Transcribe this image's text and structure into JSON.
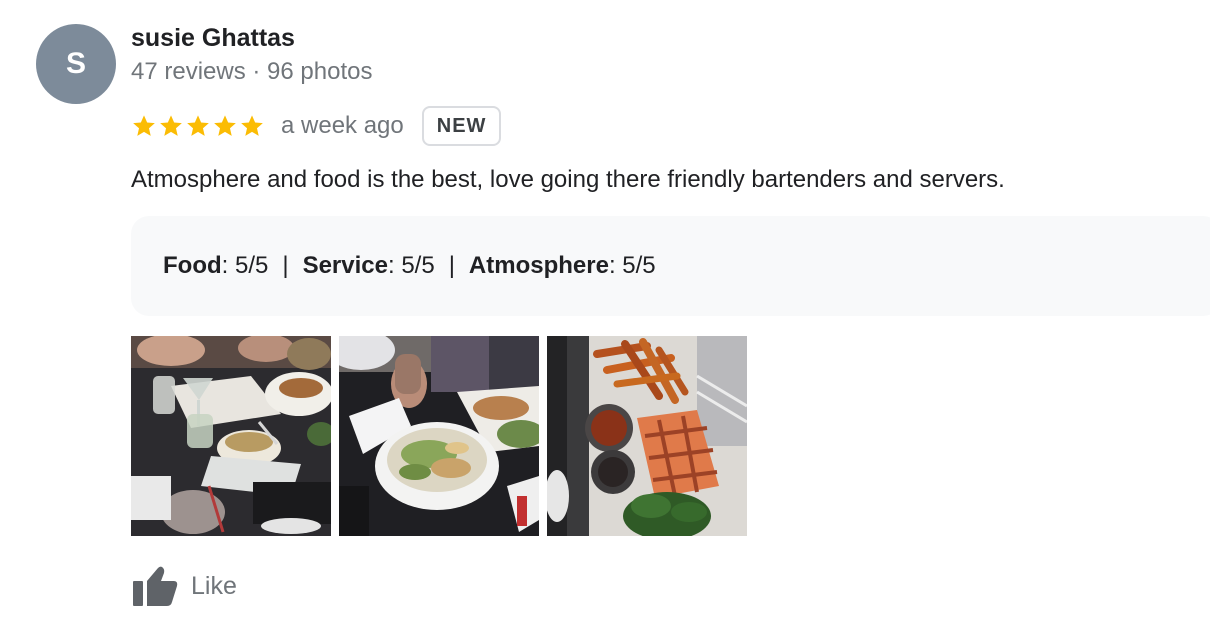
{
  "reviewer": {
    "initial": "S",
    "name": "susie Ghattas",
    "stats": "47 reviews · 96 photos",
    "avatar_color": "#7d8b9a"
  },
  "review": {
    "rating": 5,
    "max_rating": 5,
    "star_color": "#fbbc04",
    "time": "a week ago",
    "badge": "NEW",
    "text": "Atmosphere and food is the best, love going there friendly bartenders and servers."
  },
  "attributes": {
    "food_label": "Food",
    "food_value": ": 5/5",
    "service_label": "Service",
    "service_value": ": 5/5",
    "atmosphere_label": "Atmosphere",
    "atmosphere_value": ": 5/5",
    "separator": "|"
  },
  "photos": [
    {
      "subject": "restaurant table with drinks and soup"
    },
    {
      "subject": "salad bowl on table"
    },
    {
      "subject": "grilled salmon with fries and greens"
    }
  ],
  "actions": {
    "like_label": "Like",
    "like_icon": "thumbs-up-icon"
  }
}
